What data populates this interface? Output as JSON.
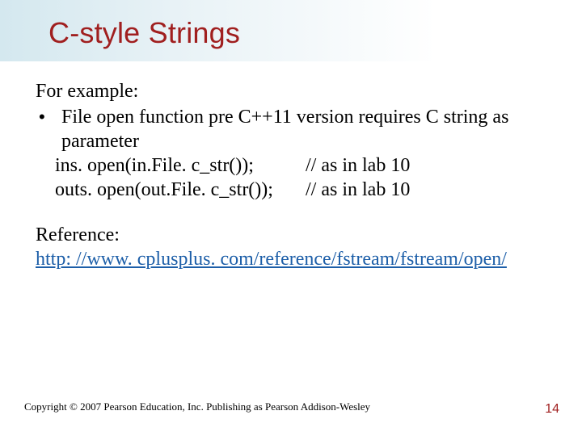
{
  "title": "C-style Strings",
  "body": {
    "lead": "For example:",
    "bullet": "File open function pre C++11 version requires C string as parameter",
    "code_lines": [
      {
        "code": "ins. open(in.File. c_str());",
        "comment": "// as in lab 10"
      },
      {
        "code": "outs. open(out.File. c_str());",
        "comment": "// as in lab 10"
      }
    ],
    "reference_label": "Reference:",
    "reference_url": "http: //www. cplusplus. com/reference/fstream/fstream/open/"
  },
  "footer": {
    "copyright": "Copyright © 2007 Pearson Education, Inc. Publishing as Pearson Addison-Wesley",
    "page_number": "14"
  }
}
